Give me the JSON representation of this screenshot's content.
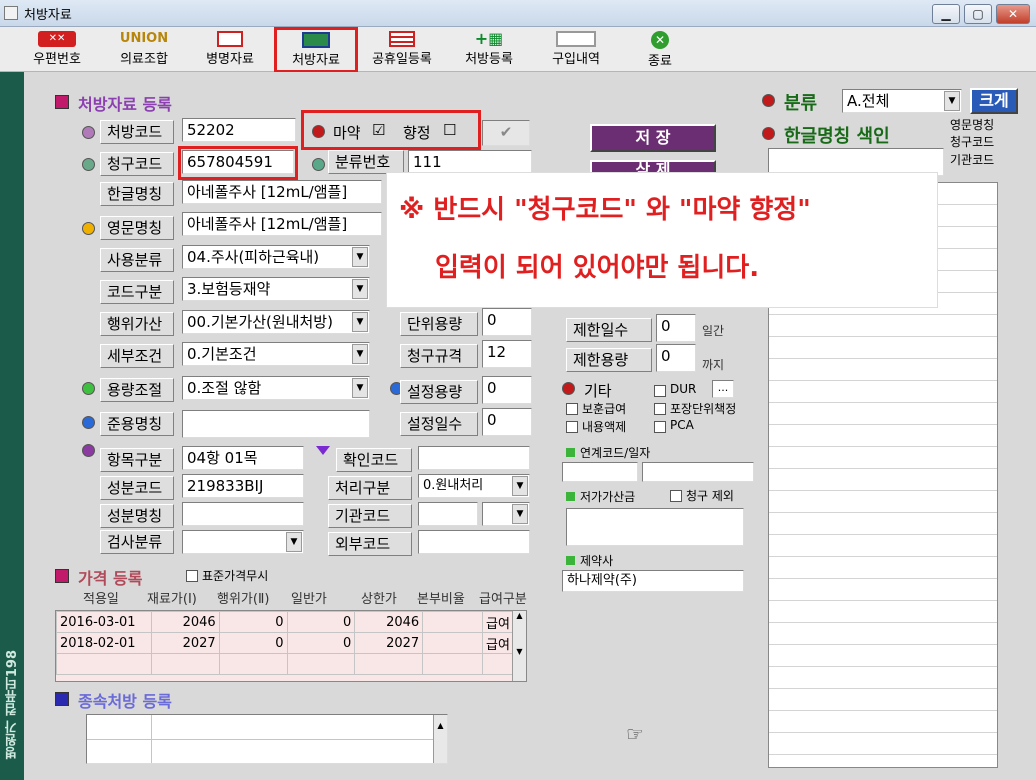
{
  "window": {
    "title": "처방자료"
  },
  "toolbar": {
    "items": [
      {
        "label": "우편번호",
        "icon": "postcode-icon"
      },
      {
        "label": "의료조합",
        "icon": "union-icon"
      },
      {
        "label": "병명자료",
        "icon": "disease-icon"
      },
      {
        "label": "처방자료",
        "icon": "prescription-icon"
      },
      {
        "label": "공휴일등록",
        "icon": "holiday-icon"
      },
      {
        "label": "처방등록",
        "icon": "register-icon"
      },
      {
        "label": "구입내역",
        "icon": "purchase-icon"
      },
      {
        "label": "종료",
        "icon": "exit-icon"
      }
    ],
    "union_text": "UNION"
  },
  "sidebar": {
    "vertical_text": "병원가 컴퓨터198"
  },
  "section": {
    "title": "처방자료 등록"
  },
  "form": {
    "labels": {
      "code": "처방코드",
      "claim_code": "청구코드",
      "hangul_name": "한글명칭",
      "eng_name": "영문명칭",
      "usage": "사용분류",
      "code_type": "코드구분",
      "action_add": "행위가산",
      "detail_cond": "세부조건",
      "dose_adj": "용량조절",
      "std_name": "준용명칭",
      "item_cat": "항목구분",
      "ingredient_code": "성분코드",
      "ingredient_name": "성분명칭",
      "test_cat": "검사분류",
      "class_no": "분류번호",
      "confirm_code": "확인코드",
      "process_type": "처리구분",
      "inst_code": "기관코드",
      "ext_code": "외부코드",
      "unit_dose": "단위용량",
      "claim_std": "청구규격",
      "set_dose": "설정용량",
      "set_days": "설정일수",
      "limit_days": "제한일수",
      "limit_dose": "제한용량",
      "narcotic": "마약",
      "psychotropic": "향정"
    },
    "values": {
      "code": "52202",
      "claim_code": "657804591",
      "hangul_name": "아네폴주사 [12mL/앰플]",
      "eng_name": "아네폴주사 [12mL/앰플]",
      "usage": "04.주사(피하근육내)",
      "code_type": "3.보험등재약",
      "action_add": "00.기본가산(원내처방)",
      "detail_cond": "0.기본조건",
      "dose_adj": "0.조절 않함",
      "std_name": "",
      "item_cat": "04항 01목",
      "ingredient_code": "219833BIJ",
      "ingredient_name": "",
      "test_cat": "",
      "class_no": "111",
      "confirm_code": "",
      "process_type": "0.원내처리",
      "inst_code": "",
      "ext_code": "",
      "unit_dose": "0",
      "claim_std": "12",
      "set_dose": "0",
      "set_days": "0",
      "limit_days": "0",
      "limit_dose": "0",
      "narcotic_check": "☑",
      "psychotropic_check": "☐"
    },
    "units": {
      "days": "일간",
      "until": "까지"
    }
  },
  "buttons": {
    "save": "저 장",
    "delete": "삭 제",
    "size": "크게",
    "ok_check": "✔"
  },
  "classify": {
    "label": "분류",
    "value": "A.전체"
  },
  "index": {
    "label": "한글명칭 색인",
    "options": [
      "영문명칭",
      "청구코드",
      "기관코드"
    ]
  },
  "etc": {
    "label": "기타",
    "checks": [
      "DUR",
      "보훈급여",
      "포장단위책정",
      "내용액제",
      "PCA"
    ],
    "more": "...",
    "link_label": "연계코드/일자",
    "low_price_label": "저가가산금",
    "claim_exclude": "청구 제외",
    "maker_label": "제약사",
    "maker_value": "하나제약(주)"
  },
  "price": {
    "label": "가격 등록",
    "std_ignore": "표준가격무시",
    "headers": [
      "적용일",
      "재료가(Ⅰ)",
      "행위가(Ⅱ)",
      "일반가",
      "상한가",
      "본부비율",
      "급여구분"
    ],
    "rows": [
      [
        "2016-03-01",
        "2046",
        "0",
        "0",
        "2046",
        "",
        "급여"
      ],
      [
        "2018-02-01",
        "2027",
        "0",
        "0",
        "2027",
        "",
        "급여"
      ]
    ]
  },
  "sub_presc": {
    "label": "종속처방 등록"
  },
  "callout": {
    "line1": "※ 반드시 \"청구코드\" 와 \"마약 향정\"",
    "line2": "입력이 되어 있어야만 됩니다."
  },
  "colors": {
    "accent_red": "#e02020",
    "sidebar": "#1a5b4a",
    "save_button": "#6b2e73"
  }
}
